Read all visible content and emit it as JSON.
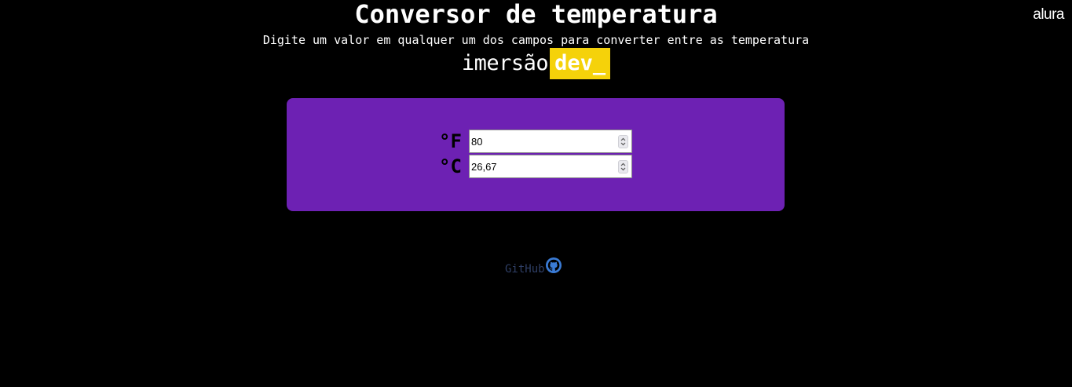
{
  "header": {
    "title": "Conversor de temperatura",
    "subtitle": "Digite um valor em qualquer um dos campos para converter entre as temperatura",
    "brand_prefix": "imersão",
    "brand_highlight": "dev_",
    "logo": "alura"
  },
  "converter": {
    "fahrenheit": {
      "unit_label": "°F",
      "value": "80"
    },
    "celsius": {
      "unit_label": "°C",
      "value": "26,67"
    }
  },
  "footer": {
    "github_label": "GitHub",
    "github_icon": "github-icon"
  },
  "colors": {
    "background": "#000000",
    "card": "#6d21b3",
    "brand_highlight": "#f5d20a",
    "github_text": "#2f3f66",
    "github_icon": "#3a7bd5"
  }
}
